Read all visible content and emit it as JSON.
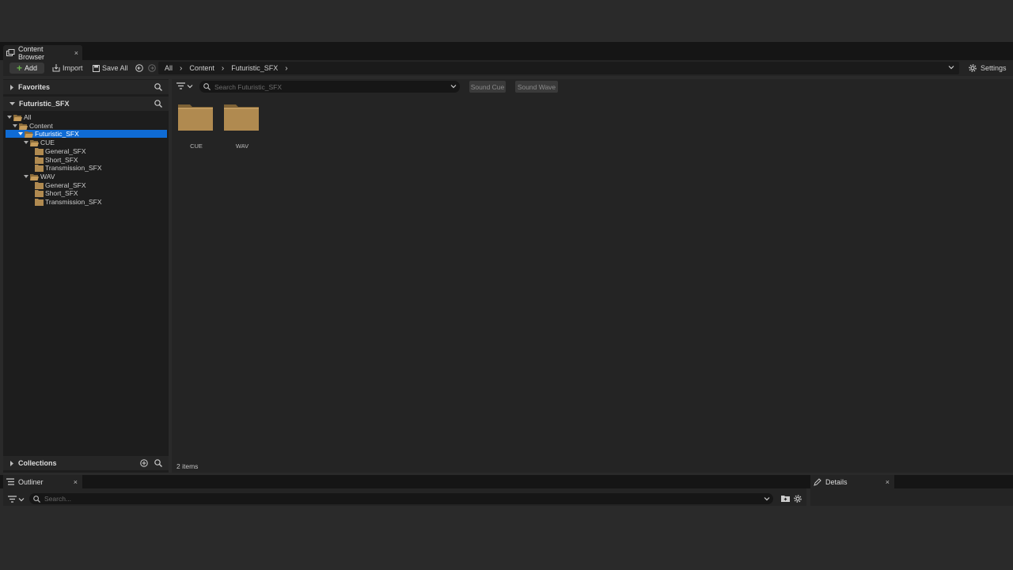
{
  "tabs": {
    "content_browser": "Content Browser",
    "close": "×"
  },
  "toolbar": {
    "add": "Add",
    "import": "Import",
    "save_all": "Save All",
    "settings": "Settings",
    "breadcrumb": [
      "All",
      "Content",
      "Futuristic_SFX"
    ]
  },
  "sidebar": {
    "favorites": "Favorites",
    "project": "Futuristic_SFX",
    "collections": "Collections",
    "tree": [
      {
        "label": "All",
        "depth": 0
      },
      {
        "label": "Content",
        "depth": 1
      },
      {
        "label": "Futuristic_SFX",
        "depth": 2,
        "selected": true
      },
      {
        "label": "CUE",
        "depth": 3
      },
      {
        "label": "General_SFX",
        "depth": 4
      },
      {
        "label": "Short_SFX",
        "depth": 4
      },
      {
        "label": "Transmission_SFX",
        "depth": 4
      },
      {
        "label": "WAV",
        "depth": 3
      },
      {
        "label": "General_SFX",
        "depth": 4
      },
      {
        "label": "Short_SFX",
        "depth": 4
      },
      {
        "label": "Transmission_SFX",
        "depth": 4
      }
    ]
  },
  "main": {
    "search_placeholder": "Search Futuristic_SFX",
    "filters": [
      "Sound Cue",
      "Sound Wave"
    ],
    "folders": [
      "CUE",
      "WAV"
    ],
    "item_count": "2 items"
  },
  "bottom": {
    "outliner": "Outliner",
    "details": "Details",
    "outliner_search_placeholder": "Search..."
  },
  "colors": {
    "accent": "#0f6bd4",
    "folder": "#b08a50",
    "add_plus": "#6ab04c"
  }
}
